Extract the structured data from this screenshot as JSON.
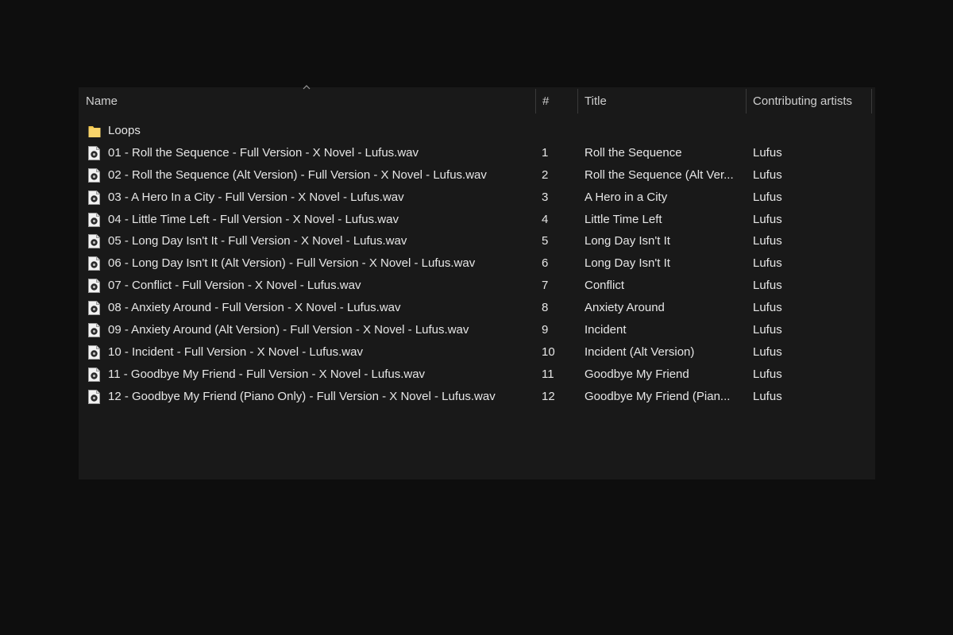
{
  "columns": {
    "name": "Name",
    "number": "#",
    "title": "Title",
    "artists": "Contributing artists"
  },
  "sort_indicator_icon": "chevron-up-icon",
  "folder": {
    "name": "Loops",
    "icon": "folder-icon",
    "icon_color": "#f3c74c"
  },
  "files": [
    {
      "name": "01 - Roll the Sequence - Full Version - X Novel - Lufus.wav",
      "number": "1",
      "title": "Roll the Sequence",
      "artist": "Lufus"
    },
    {
      "name": "02 - Roll the Sequence (Alt Version) - Full Version - X Novel - Lufus.wav",
      "number": "2",
      "title": "Roll the Sequence (Alt Ver...",
      "artist": "Lufus"
    },
    {
      "name": "03 - A Hero In a City - Full Version - X Novel - Lufus.wav",
      "number": "3",
      "title": "A Hero in a City",
      "artist": "Lufus"
    },
    {
      "name": "04 - Little Time Left - Full Version - X Novel - Lufus.wav",
      "number": "4",
      "title": "Little Time Left",
      "artist": "Lufus"
    },
    {
      "name": "05 - Long Day Isn't It - Full Version - X Novel - Lufus.wav",
      "number": "5",
      "title": "Long Day Isn't It",
      "artist": "Lufus"
    },
    {
      "name": "06 - Long Day Isn't It (Alt Version) - Full Version - X Novel - Lufus.wav",
      "number": "6",
      "title": "Long Day Isn't It",
      "artist": "Lufus"
    },
    {
      "name": "07 - Conflict - Full Version - X Novel - Lufus.wav",
      "number": "7",
      "title": "Conflict",
      "artist": "Lufus"
    },
    {
      "name": "08 - Anxiety Around - Full Version - X Novel - Lufus.wav",
      "number": "8",
      "title": "Anxiety Around",
      "artist": "Lufus"
    },
    {
      "name": "09 - Anxiety Around (Alt Version) - Full Version - X Novel - Lufus.wav",
      "number": "9",
      "title": "Incident",
      "artist": "Lufus"
    },
    {
      "name": "10 - Incident - Full Version - X Novel - Lufus.wav",
      "number": "10",
      "title": "Incident (Alt Version)",
      "artist": "Lufus"
    },
    {
      "name": "11 - Goodbye My Friend - Full Version - X Novel - Lufus.wav",
      "number": "11",
      "title": "Goodbye My Friend",
      "artist": "Lufus"
    },
    {
      "name": "12 - Goodbye My Friend (Piano Only) - Full Version - X Novel - Lufus.wav",
      "number": "12",
      "title": "Goodbye My Friend (Pian...",
      "artist": "Lufus"
    }
  ],
  "file_icon": "audio-file-icon"
}
